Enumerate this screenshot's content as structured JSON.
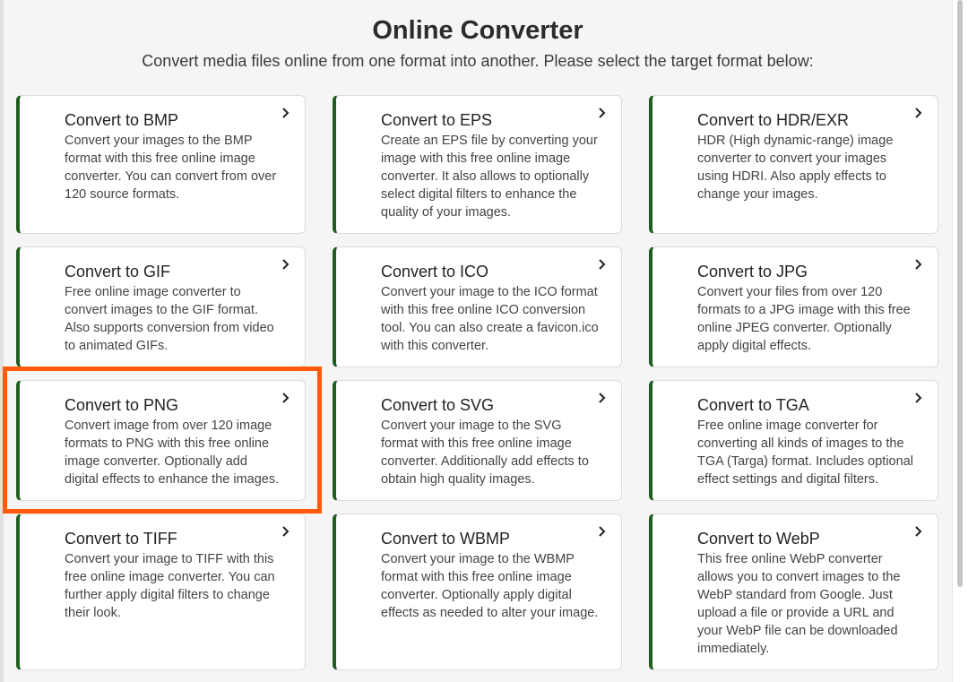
{
  "header": {
    "title": "Online Converter",
    "subtitle": "Convert media files online from one format into another. Please select the target format below:"
  },
  "accent_color": "#1e5e1e",
  "highlight_color": "#ff5a0a",
  "highlighted_card": "Convert to PNG",
  "cards": [
    {
      "title": "Convert to BMP",
      "description": "Convert your images to the BMP format with this free online image converter. You can convert from over 120 source formats.",
      "icon": "chevron-right-icon"
    },
    {
      "title": "Convert to EPS",
      "description": "Create an EPS file by converting your image with this free online image converter. It also allows to optionally select digital filters to enhance the quality of your images.",
      "icon": "chevron-right-icon"
    },
    {
      "title": "Convert to HDR/EXR",
      "description": "HDR (High dynamic-range) image converter to convert your images using HDRI. Also apply effects to change your images.",
      "icon": "chevron-right-icon"
    },
    {
      "title": "Convert to GIF",
      "description": "Free online image converter to convert images to the GIF format. Also supports conversion from video to animated GIFs.",
      "icon": "chevron-right-icon"
    },
    {
      "title": "Convert to ICO",
      "description": "Convert your image to the ICO format with this free online ICO conversion tool. You can also create a favicon.ico with this converter.",
      "icon": "chevron-right-icon"
    },
    {
      "title": "Convert to JPG",
      "description": "Convert your files from over 120 formats to a JPG image with this free online JPEG converter. Optionally apply digital effects.",
      "icon": "chevron-right-icon"
    },
    {
      "title": "Convert to PNG",
      "description": "Convert image from over 120 image formats to PNG with this free online image converter. Optionally add digital effects to enhance the images.",
      "icon": "chevron-right-icon"
    },
    {
      "title": "Convert to SVG",
      "description": "Convert your image to the SVG format with this free online image converter. Additionally add effects to obtain high quality images.",
      "icon": "chevron-right-icon"
    },
    {
      "title": "Convert to TGA",
      "description": "Free online image converter for converting all kinds of images to the TGA (Targa) format. Includes optional effect settings and digital filters.",
      "icon": "chevron-right-icon"
    },
    {
      "title": "Convert to TIFF",
      "description": "Convert your image to TIFF with this free online image converter. You can further apply digital filters to change their look.",
      "icon": "chevron-right-icon"
    },
    {
      "title": "Convert to WBMP",
      "description": "Convert your image to the WBMP format with this free online image converter. Optionally apply digital effects as needed to alter your image.",
      "icon": "chevron-right-icon"
    },
    {
      "title": "Convert to WebP",
      "description": "This free online WebP converter allows you to convert images to the WebP standard from Google. Just upload a file or provide a URL and your WebP file can be downloaded immediately.",
      "icon": "chevron-right-icon"
    }
  ]
}
